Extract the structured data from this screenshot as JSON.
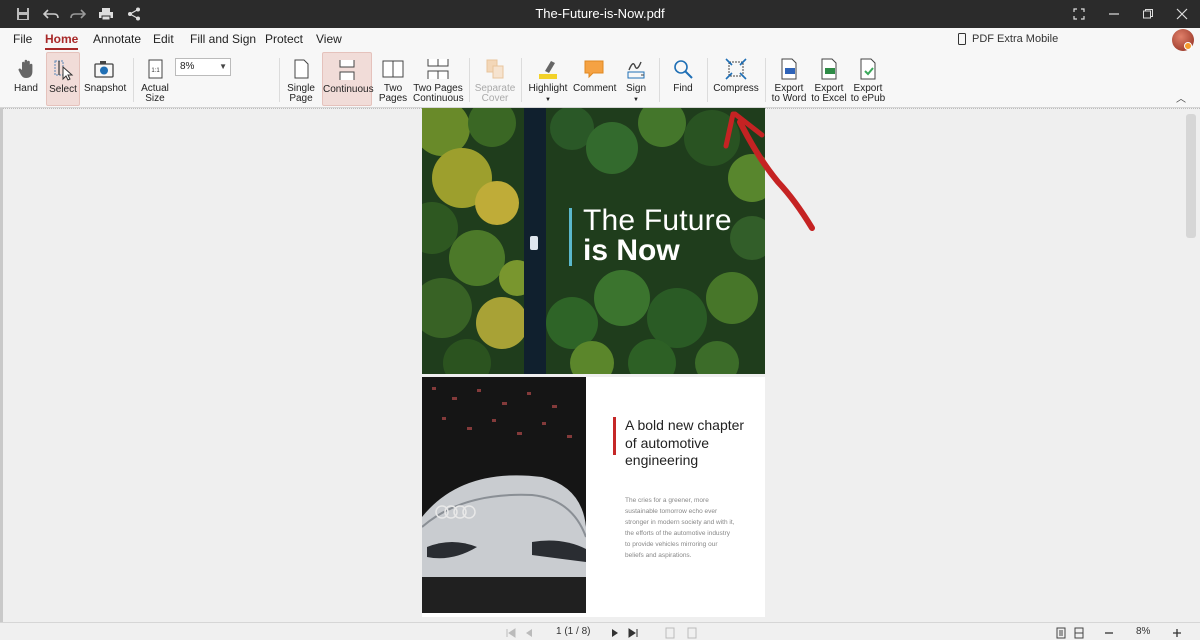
{
  "window": {
    "title": "The-Future-is-Now.pdf"
  },
  "menu": {
    "file": "File",
    "home": "Home",
    "annotate": "Annotate",
    "edit": "Edit",
    "fill_sign": "Fill and Sign",
    "protect": "Protect",
    "view": "View",
    "mobile_label": "PDF Extra Mobile"
  },
  "ribbon": {
    "hand": "Hand",
    "select": "Select",
    "snapshot": "Snapshot",
    "actual_size_1": "Actual",
    "actual_size_2": "Size",
    "zoom_value": "8%",
    "single_page_1": "Single",
    "single_page_2": "Page",
    "continuous": "Continuous",
    "two_pages_1": "Two",
    "two_pages_2": "Pages",
    "two_pages_cont_1": "Two Pages",
    "two_pages_cont_2": "Continuous",
    "separate_cover_1": "Separate",
    "separate_cover_2": "Cover",
    "highlight": "Highlight",
    "comment": "Comment",
    "sign": "Sign",
    "find": "Find",
    "compress": "Compress",
    "export_word_1": "Export",
    "export_word_2": "to Word",
    "export_excel_1": "Export",
    "export_excel_2": "to Excel",
    "export_epub_1": "Export",
    "export_epub_2": "to ePub"
  },
  "document": {
    "page1_title_line1": "The Future",
    "page1_title_line2": "is Now",
    "page2_heading": "A bold new chapter of automotive engineering",
    "page2_body": "The cries for a greener, more sustainable tomorrow echo ever stronger in modern society and with it, the efforts of the automotive industry to provide vehicles mirroring our beliefs and aspirations."
  },
  "statusbar": {
    "page_indicator": "1 (1 / 8)",
    "zoom": "8%"
  },
  "colors": {
    "accent": "#a82828",
    "titlebar": "#2b2b2b",
    "title_bar_accent": "#5bb8cc",
    "heading_bar_red": "#c52828"
  }
}
